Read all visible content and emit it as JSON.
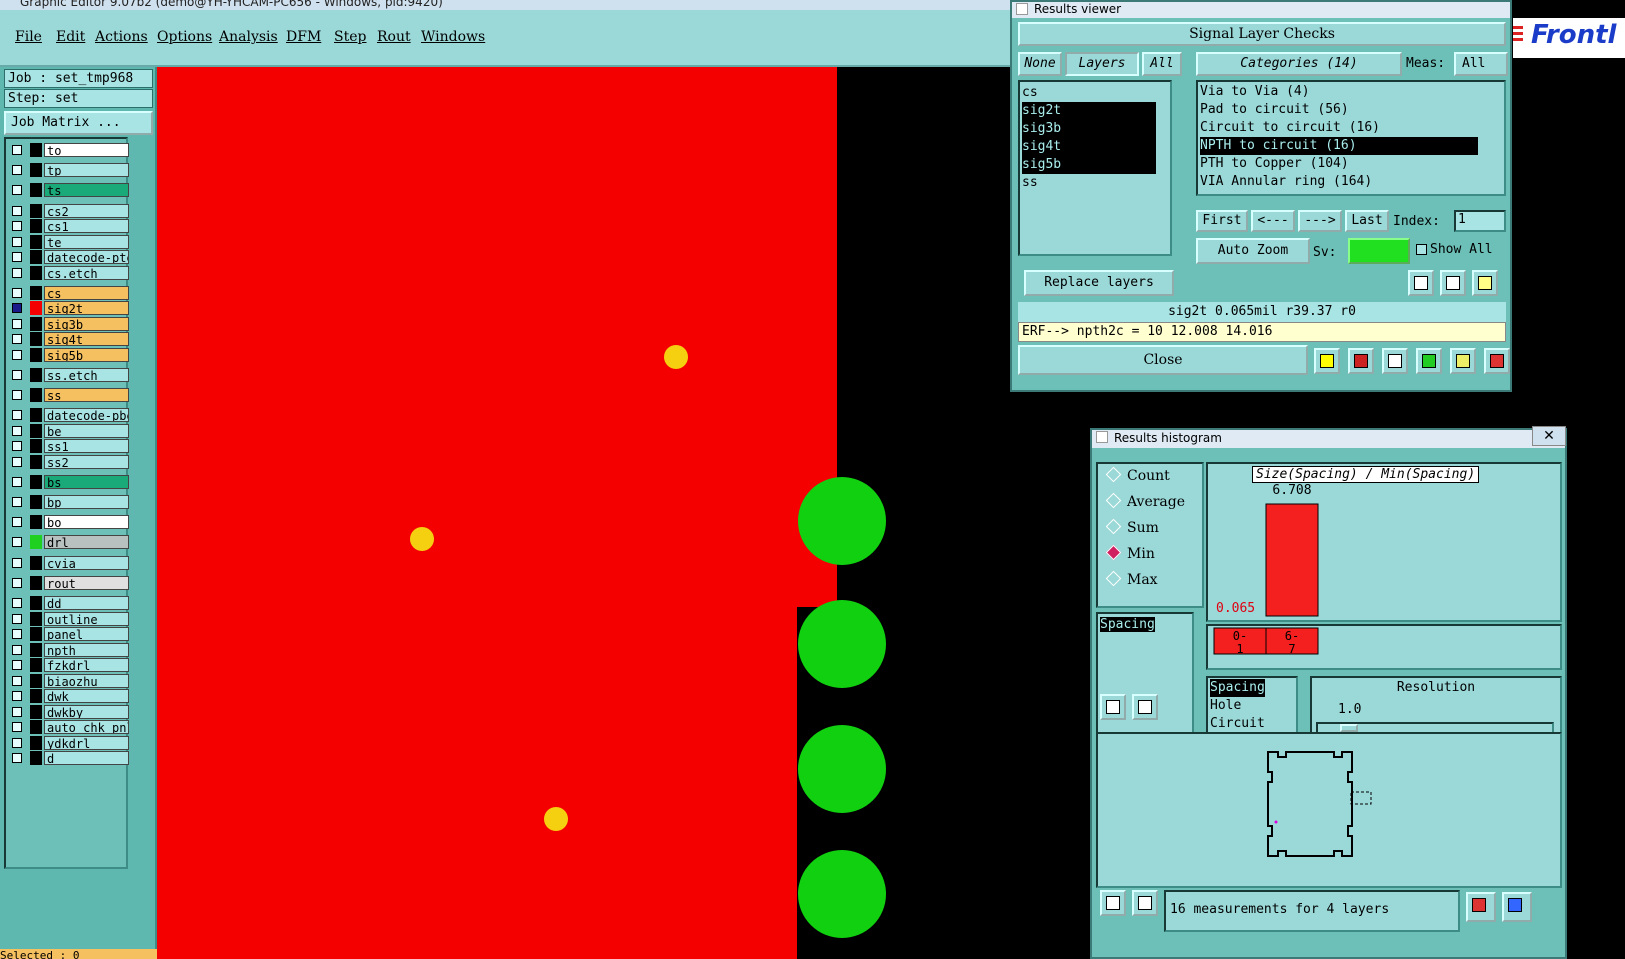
{
  "window": {
    "title": "Graphic Editor 9.07b2 (demo@YH-YHCAM-PC656 - Windows, pid:9420)"
  },
  "menu": [
    "File",
    "Edit",
    "Actions",
    "Options",
    "Analysis",
    "DFM",
    "Step",
    "Rout",
    "Windows"
  ],
  "brand": "Frontl",
  "left": {
    "job": "Job : set_tmp968",
    "step": "Step: set",
    "job_matrix": "Job Matrix ...",
    "layers": [
      {
        "name": "to",
        "color": "#ffffff"
      },
      {
        "name": "tp",
        "color": "#a9e4e4"
      },
      {
        "name": "ts",
        "color": "#1aaa7a"
      },
      {
        "name": "cs2",
        "color": "#a9e4e4"
      },
      {
        "name": "cs1",
        "color": "#a9e4e4"
      },
      {
        "name": "te",
        "color": "#a9e4e4"
      },
      {
        "name": "datecode-pte",
        "color": "#a9e4e4"
      },
      {
        "name": "cs.etch",
        "color": "#a9e4e4"
      },
      {
        "name": "cs",
        "color": "#f5c060"
      },
      {
        "name": "sig2t",
        "color": "#f5c060",
        "active": true
      },
      {
        "name": "sig3b",
        "color": "#f5c060"
      },
      {
        "name": "sig4t",
        "color": "#f5c060"
      },
      {
        "name": "sig5b",
        "color": "#f5c060"
      },
      {
        "name": "ss.etch",
        "color": "#a9e4e4"
      },
      {
        "name": "ss",
        "color": "#f5c060"
      },
      {
        "name": "datecode-pbe",
        "color": "#a9e4e4"
      },
      {
        "name": "be",
        "color": "#a9e4e4"
      },
      {
        "name": "ss1",
        "color": "#a9e4e4"
      },
      {
        "name": "ss2",
        "color": "#a9e4e4"
      },
      {
        "name": "bs",
        "color": "#1aaa7a"
      },
      {
        "name": "bp",
        "color": "#a9e4e4"
      },
      {
        "name": "bo",
        "color": "#ffffff"
      },
      {
        "name": "drl",
        "color": "#b8c0c0",
        "swatch": "#20d020"
      },
      {
        "name": "cvia",
        "color": "#a9e4e4"
      },
      {
        "name": "rout",
        "color": "#e0e0e0"
      },
      {
        "name": "dd",
        "color": "#a9e4e4"
      },
      {
        "name": "outline",
        "color": "#a9e4e4"
      },
      {
        "name": "panel",
        "color": "#a9e4e4"
      },
      {
        "name": "npth",
        "color": "#a9e4e4"
      },
      {
        "name": "fzkdrl",
        "color": "#a9e4e4"
      },
      {
        "name": "biaozhu",
        "color": "#a9e4e4"
      },
      {
        "name": "dwk",
        "color": "#a9e4e4"
      },
      {
        "name": "dwkby",
        "color": "#a9e4e4"
      },
      {
        "name": "auto_chk_pnl",
        "color": "#a9e4e4"
      },
      {
        "name": "ydkdrl",
        "color": "#a9e4e4"
      },
      {
        "name": "d",
        "color": "#a9e4e4"
      }
    ],
    "selected": "Selected : 0"
  },
  "results_viewer": {
    "title": "Results viewer",
    "header": "Signal Layer Checks",
    "none_btn": "None",
    "layers_btn": "Layers",
    "all_btn": "All",
    "categories_btn": "Categories (14)",
    "meas_label": "Meas:",
    "meas_value": "All",
    "layer_list": [
      {
        "name": "cs",
        "selected": false
      },
      {
        "name": "sig2t",
        "selected": true
      },
      {
        "name": "sig3b",
        "selected": true
      },
      {
        "name": "sig4t",
        "selected": true
      },
      {
        "name": "sig5b",
        "selected": true
      },
      {
        "name": "ss",
        "selected": false
      }
    ],
    "category_list": [
      {
        "name": "Via to Via (4)",
        "selected": false
      },
      {
        "name": "Pad to circuit (56)",
        "selected": false
      },
      {
        "name": "Circuit to circuit (16)",
        "selected": false
      },
      {
        "name": "NPTH to circuit (16)",
        "selected": true
      },
      {
        "name": "PTH to Copper (104)",
        "selected": false
      },
      {
        "name": "VIA Annular ring (164)",
        "selected": false
      }
    ],
    "first": "First",
    "prev": "<---",
    "next": "--->",
    "last": "Last",
    "index_label": "Index:",
    "index_value": "1",
    "auto_zoom": "Auto Zoom",
    "sv_label": "Sv:",
    "show_all": "Show All",
    "replace_layers": "Replace layers",
    "icon_del": "DEL",
    "icon_ref": "REF",
    "icon_undo": "UNDO",
    "status": "sig2t 0.065mil   r39.37  r0",
    "erf": "ERF--> npth2c = 10 12.008 14.016",
    "close": "Close"
  },
  "histogram": {
    "title": "Results histogram",
    "modes": [
      {
        "label": "Count",
        "checked": false
      },
      {
        "label": "Average",
        "checked": false
      },
      {
        "label": "Sum",
        "checked": false
      },
      {
        "label": "Min",
        "checked": true
      },
      {
        "label": "Max",
        "checked": false
      }
    ],
    "metric_list": [
      "Spacing"
    ],
    "chart_title": "Size(Spacing) / Min(Spacing)",
    "bar_label": "6.708",
    "min_label": "0.065",
    "bins": [
      "0-\n1",
      "6-\n7"
    ],
    "type_list": [
      "Spacing",
      "Hole",
      "Circuit"
    ],
    "resolution_label": "Resolution",
    "resolution_value": "1.0",
    "icon_del": "DEL",
    "icon_ref": "REF",
    "summary": "16 measurements for 4 layers",
    "chart_data": {
      "type": "bar",
      "categories": [
        "0-1",
        "6-7"
      ],
      "values": [
        0.065,
        6.708
      ],
      "title": "Size(Spacing) / Min(Spacing)",
      "xlabel": "",
      "ylabel": ""
    }
  }
}
